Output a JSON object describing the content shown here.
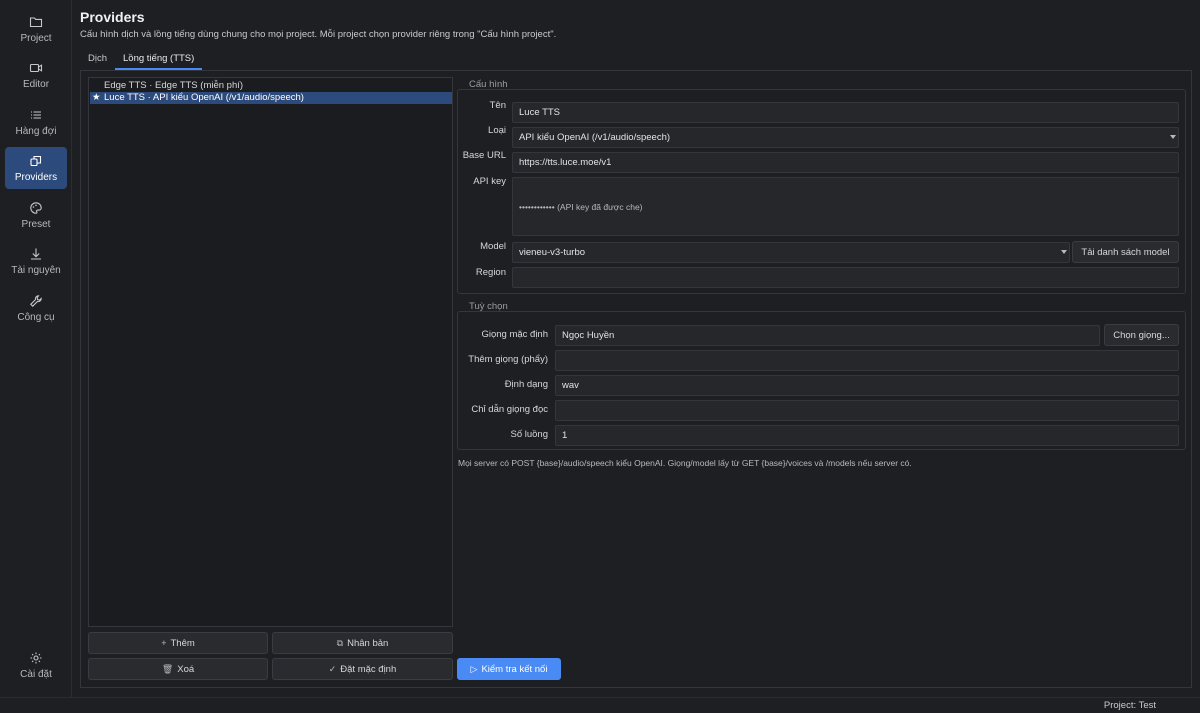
{
  "sidebar": {
    "items": [
      {
        "label": "Project",
        "icon": "folder-icon"
      },
      {
        "label": "Editor",
        "icon": "video-icon"
      },
      {
        "label": "Hàng đợi",
        "icon": "list-icon"
      },
      {
        "label": "Providers",
        "icon": "providers-icon",
        "active": true
      },
      {
        "label": "Preset",
        "icon": "palette-icon"
      },
      {
        "label": "Tài nguyên",
        "icon": "download-icon"
      },
      {
        "label": "Công cụ",
        "icon": "wrench-icon"
      }
    ],
    "settings_label": "Cài đặt"
  },
  "header": {
    "title": "Providers",
    "subtitle": "Cấu hình dịch và lồng tiếng dùng chung cho mọi project. Mỗi project chọn provider riêng trong \"Cấu hình project\"."
  },
  "tabs": [
    {
      "label": "Dịch"
    },
    {
      "label": "Lồng tiếng (TTS)",
      "active": true
    }
  ],
  "provider_list": [
    {
      "text": "Edge TTS  ·  Edge TTS (miễn phí)",
      "default": false
    },
    {
      "star": "★",
      "text": "Luce TTS  ·  API kiểu OpenAI (/v1/audio/speech)",
      "default": true
    }
  ],
  "list_buttons": {
    "add": "Thêm",
    "duplicate": "Nhân bản",
    "delete": "Xoá",
    "set_default": "Đặt mặc định"
  },
  "config": {
    "group_title": "Cấu hình",
    "name_label": "Tên",
    "name_value": "Luce TTS",
    "type_label": "Loại",
    "type_value": "API kiểu OpenAI (/v1/audio/speech)",
    "base_url_label": "Base URL",
    "base_url_value": "https://tts.luce.moe/v1",
    "api_key_label": "API key",
    "api_key_value": "••••••••••••  (API key đã được che)",
    "model_label": "Model",
    "model_value": "vieneu-v3-turbo",
    "load_models_button": "Tải danh sách model",
    "region_label": "Region",
    "region_value": ""
  },
  "options": {
    "group_title": "Tuỳ chọn",
    "default_voice_label": "Giọng mặc định",
    "default_voice_value": "Ngọc Huyền",
    "choose_voice_button": "Chọn giọng...",
    "extra_voices_label": "Thêm giọng (phẩy)",
    "extra_voices_value": "",
    "format_label": "Định dạng",
    "format_value": "wav",
    "voice_instructions_label": "Chỉ dẫn giọng đọc",
    "voice_instructions_value": "",
    "threads_label": "Số luồng",
    "threads_value": "1"
  },
  "hint_text": "Mọi server có POST {base}/audio/speech kiểu OpenAI. Giọng/model lấy từ GET {base}/voices và /models nếu server có.",
  "test_connection_button": "Kiểm tra kết nối",
  "status": {
    "project": "Project: Test"
  },
  "colors": {
    "accent": "#4a8af4",
    "selection": "#2c4a7c",
    "background": "#1e1f22"
  }
}
